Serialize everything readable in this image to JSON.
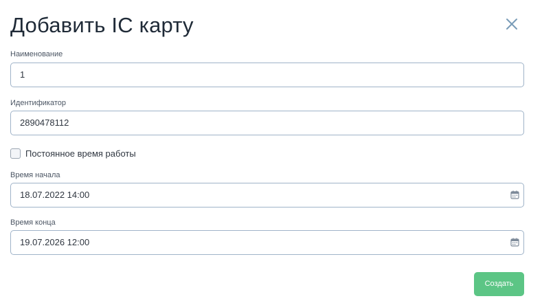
{
  "dialog": {
    "title": "Добавить IC карту",
    "close_icon": "close-icon"
  },
  "fields": {
    "name": {
      "label": "Наименование",
      "value": "1"
    },
    "identifier": {
      "label": "Идентификатор",
      "value": "2890478112"
    },
    "permanent": {
      "label": "Постоянное время работы",
      "checked": false
    },
    "start_time": {
      "label": "Время начала",
      "value": "18.07.2022 14:00",
      "icon": "calendar-icon"
    },
    "end_time": {
      "label": "Время конца",
      "value": "19.07.2026 12:00",
      "icon": "calendar-icon"
    }
  },
  "actions": {
    "create_label": "Создать"
  },
  "colors": {
    "accent": "#5cc585",
    "close": "#7a9cb8",
    "border": "#9fb3c8"
  }
}
